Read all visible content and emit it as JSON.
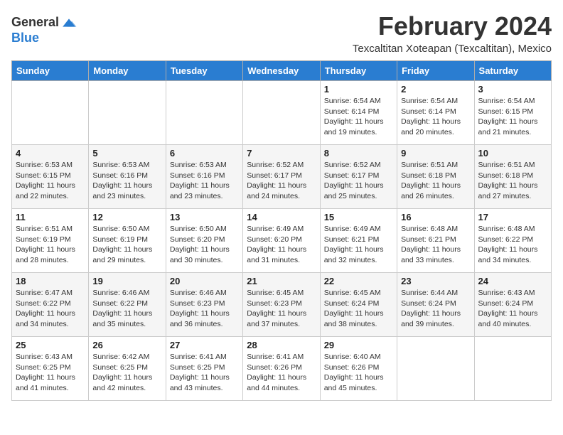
{
  "logo": {
    "line1": "General",
    "line2": "Blue"
  },
  "title": "February 2024",
  "location": "Texcaltitan Xoteapan (Texcaltitan), Mexico",
  "days_of_week": [
    "Sunday",
    "Monday",
    "Tuesday",
    "Wednesday",
    "Thursday",
    "Friday",
    "Saturday"
  ],
  "weeks": [
    [
      {
        "day": "",
        "info": ""
      },
      {
        "day": "",
        "info": ""
      },
      {
        "day": "",
        "info": ""
      },
      {
        "day": "",
        "info": ""
      },
      {
        "day": "1",
        "info": "Sunrise: 6:54 AM\nSunset: 6:14 PM\nDaylight: 11 hours and 19 minutes."
      },
      {
        "day": "2",
        "info": "Sunrise: 6:54 AM\nSunset: 6:14 PM\nDaylight: 11 hours and 20 minutes."
      },
      {
        "day": "3",
        "info": "Sunrise: 6:54 AM\nSunset: 6:15 PM\nDaylight: 11 hours and 21 minutes."
      }
    ],
    [
      {
        "day": "4",
        "info": "Sunrise: 6:53 AM\nSunset: 6:15 PM\nDaylight: 11 hours and 22 minutes."
      },
      {
        "day": "5",
        "info": "Sunrise: 6:53 AM\nSunset: 6:16 PM\nDaylight: 11 hours and 23 minutes."
      },
      {
        "day": "6",
        "info": "Sunrise: 6:53 AM\nSunset: 6:16 PM\nDaylight: 11 hours and 23 minutes."
      },
      {
        "day": "7",
        "info": "Sunrise: 6:52 AM\nSunset: 6:17 PM\nDaylight: 11 hours and 24 minutes."
      },
      {
        "day": "8",
        "info": "Sunrise: 6:52 AM\nSunset: 6:17 PM\nDaylight: 11 hours and 25 minutes."
      },
      {
        "day": "9",
        "info": "Sunrise: 6:51 AM\nSunset: 6:18 PM\nDaylight: 11 hours and 26 minutes."
      },
      {
        "day": "10",
        "info": "Sunrise: 6:51 AM\nSunset: 6:18 PM\nDaylight: 11 hours and 27 minutes."
      }
    ],
    [
      {
        "day": "11",
        "info": "Sunrise: 6:51 AM\nSunset: 6:19 PM\nDaylight: 11 hours and 28 minutes."
      },
      {
        "day": "12",
        "info": "Sunrise: 6:50 AM\nSunset: 6:19 PM\nDaylight: 11 hours and 29 minutes."
      },
      {
        "day": "13",
        "info": "Sunrise: 6:50 AM\nSunset: 6:20 PM\nDaylight: 11 hours and 30 minutes."
      },
      {
        "day": "14",
        "info": "Sunrise: 6:49 AM\nSunset: 6:20 PM\nDaylight: 11 hours and 31 minutes."
      },
      {
        "day": "15",
        "info": "Sunrise: 6:49 AM\nSunset: 6:21 PM\nDaylight: 11 hours and 32 minutes."
      },
      {
        "day": "16",
        "info": "Sunrise: 6:48 AM\nSunset: 6:21 PM\nDaylight: 11 hours and 33 minutes."
      },
      {
        "day": "17",
        "info": "Sunrise: 6:48 AM\nSunset: 6:22 PM\nDaylight: 11 hours and 34 minutes."
      }
    ],
    [
      {
        "day": "18",
        "info": "Sunrise: 6:47 AM\nSunset: 6:22 PM\nDaylight: 11 hours and 34 minutes."
      },
      {
        "day": "19",
        "info": "Sunrise: 6:46 AM\nSunset: 6:22 PM\nDaylight: 11 hours and 35 minutes."
      },
      {
        "day": "20",
        "info": "Sunrise: 6:46 AM\nSunset: 6:23 PM\nDaylight: 11 hours and 36 minutes."
      },
      {
        "day": "21",
        "info": "Sunrise: 6:45 AM\nSunset: 6:23 PM\nDaylight: 11 hours and 37 minutes."
      },
      {
        "day": "22",
        "info": "Sunrise: 6:45 AM\nSunset: 6:24 PM\nDaylight: 11 hours and 38 minutes."
      },
      {
        "day": "23",
        "info": "Sunrise: 6:44 AM\nSunset: 6:24 PM\nDaylight: 11 hours and 39 minutes."
      },
      {
        "day": "24",
        "info": "Sunrise: 6:43 AM\nSunset: 6:24 PM\nDaylight: 11 hours and 40 minutes."
      }
    ],
    [
      {
        "day": "25",
        "info": "Sunrise: 6:43 AM\nSunset: 6:25 PM\nDaylight: 11 hours and 41 minutes."
      },
      {
        "day": "26",
        "info": "Sunrise: 6:42 AM\nSunset: 6:25 PM\nDaylight: 11 hours and 42 minutes."
      },
      {
        "day": "27",
        "info": "Sunrise: 6:41 AM\nSunset: 6:25 PM\nDaylight: 11 hours and 43 minutes."
      },
      {
        "day": "28",
        "info": "Sunrise: 6:41 AM\nSunset: 6:26 PM\nDaylight: 11 hours and 44 minutes."
      },
      {
        "day": "29",
        "info": "Sunrise: 6:40 AM\nSunset: 6:26 PM\nDaylight: 11 hours and 45 minutes."
      },
      {
        "day": "",
        "info": ""
      },
      {
        "day": "",
        "info": ""
      }
    ]
  ]
}
